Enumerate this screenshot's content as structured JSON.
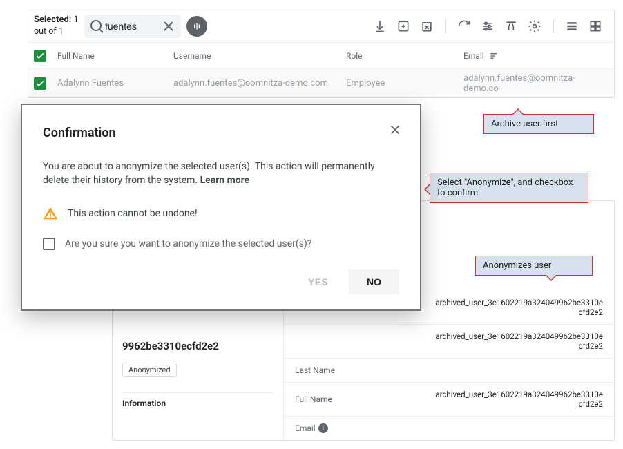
{
  "toolbar": {
    "selected_label": "Selected: 1",
    "out_of_label": "out of 1",
    "search_value": "fuentes"
  },
  "table": {
    "headers": {
      "full_name": "Full Name",
      "username": "Username",
      "role": "Role",
      "email": "Email"
    },
    "row": {
      "full_name": "Adalynn Fuentes",
      "username": "adalynn.fuentes@oomnitza-demo.com",
      "role": "Employee",
      "email": "adalynn.fuentes@oomnitza-demo.co"
    }
  },
  "detail": {
    "hash_name": "9962be3310ecfd2e2",
    "badge": "Anonymized",
    "section": "Information",
    "rows": {
      "r0_val": "archived_user_3e1602219a324049962be3310ecfd2e2",
      "r1_val": "archived_user_3e1602219a324049962be3310ecfd2e2",
      "last_name_lbl": "Last Name",
      "last_name_val": "",
      "full_name_lbl": "Full Name",
      "full_name_val": "archived_user_3e1602219a324049962be3310ecfd2e2",
      "email_lbl": "Email"
    }
  },
  "callouts": {
    "archive": "Archive user first",
    "select_anon": "Select \"Anonymize\", and checkbox to confirm",
    "anonymizes": "Anonymizes user"
  },
  "modal": {
    "title": "Confirmation",
    "body_text": "You are about to anonymize the selected user(s). This action will permanently delete their history from the system.  ",
    "learn_more": "Learn more",
    "warning": "This action cannot be undone!",
    "confirm_question": "Are you sure you want to anonymize the selected user(s)?",
    "yes": "YES",
    "no": "NO"
  }
}
